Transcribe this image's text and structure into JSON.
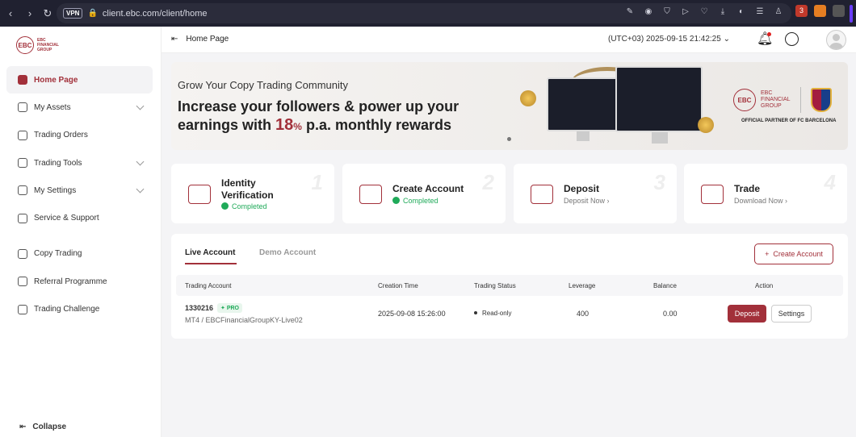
{
  "browser": {
    "url": "client.ebc.com/client/home",
    "vpn_label": "VPN",
    "ext_badge": "3"
  },
  "sidebar": {
    "items": [
      {
        "label": "Home Page"
      },
      {
        "label": "My Assets"
      },
      {
        "label": "Trading Orders"
      },
      {
        "label": "Trading Tools"
      },
      {
        "label": "My Settings"
      },
      {
        "label": "Service & Support"
      },
      {
        "label": "Copy Trading"
      },
      {
        "label": "Referral Programme"
      },
      {
        "label": "Trading Challenge"
      }
    ],
    "collapse_label": "Collapse"
  },
  "topbar": {
    "breadcrumb": "Home Page",
    "clock": "(UTC+03)  2025-09-15 21:42:25"
  },
  "banner": {
    "headline": "Grow Your Copy Trading Community",
    "line1": "Increase your followers & power up your",
    "line2_pre": "earnings with ",
    "line2_num": "18",
    "line2_pct": "%",
    "line2_post": " p.a. monthly rewards",
    "brand_name": "EBC",
    "brand_text_1": "FINANCIAL",
    "brand_text_2": "GROUP",
    "partner_text": "OFFICIAL PARTNER OF FC BARCELONA"
  },
  "steps": [
    {
      "title_1": "Identity",
      "title_2": "Verification",
      "sub": "Completed",
      "num": "1"
    },
    {
      "title_1": "Create Account",
      "sub": "Completed",
      "num": "2"
    },
    {
      "title_1": "Deposit",
      "sub": "Deposit Now ›",
      "num": "3"
    },
    {
      "title_1": "Trade",
      "sub": "Download Now ›",
      "num": "4"
    }
  ],
  "accounts": {
    "tab_live": "Live Account",
    "tab_demo": "Demo Account",
    "create_label": "Create Account",
    "columns": [
      "Trading Account",
      "Creation Time",
      "Trading Status",
      "Leverage",
      "Balance",
      "Action"
    ],
    "row": {
      "number": "1330216",
      "badge": "PRO",
      "server": "MT4 / EBCFinancialGroupKY-Live02",
      "created": "2025-09-08 15:26:00",
      "status": "Read-only",
      "leverage": "400",
      "balance": "0.00",
      "deposit_label": "Deposit",
      "settings_label": "Settings"
    }
  },
  "colors": {
    "accent": "#a2303a",
    "success": "#1faa59"
  }
}
